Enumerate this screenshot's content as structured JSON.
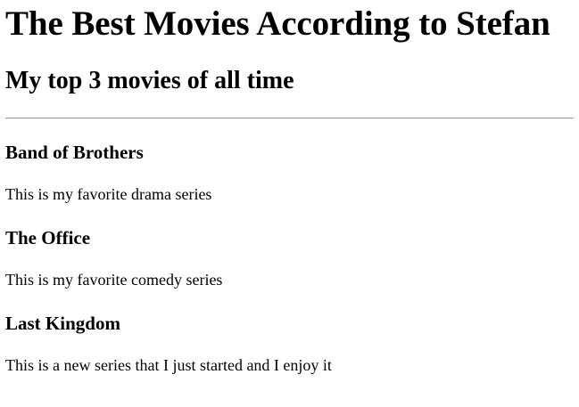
{
  "page": {
    "title": "The Best Movies According to Stefan",
    "subtitle": "My top 3 movies of all time"
  },
  "movies": [
    {
      "title": "Band of Brothers",
      "description": "This is my favorite drama series"
    },
    {
      "title": "The Office",
      "description": "This is my favorite comedy series"
    },
    {
      "title": "Last Kingdom",
      "description": "This is a new series that I just started and I enjoy it"
    }
  ]
}
